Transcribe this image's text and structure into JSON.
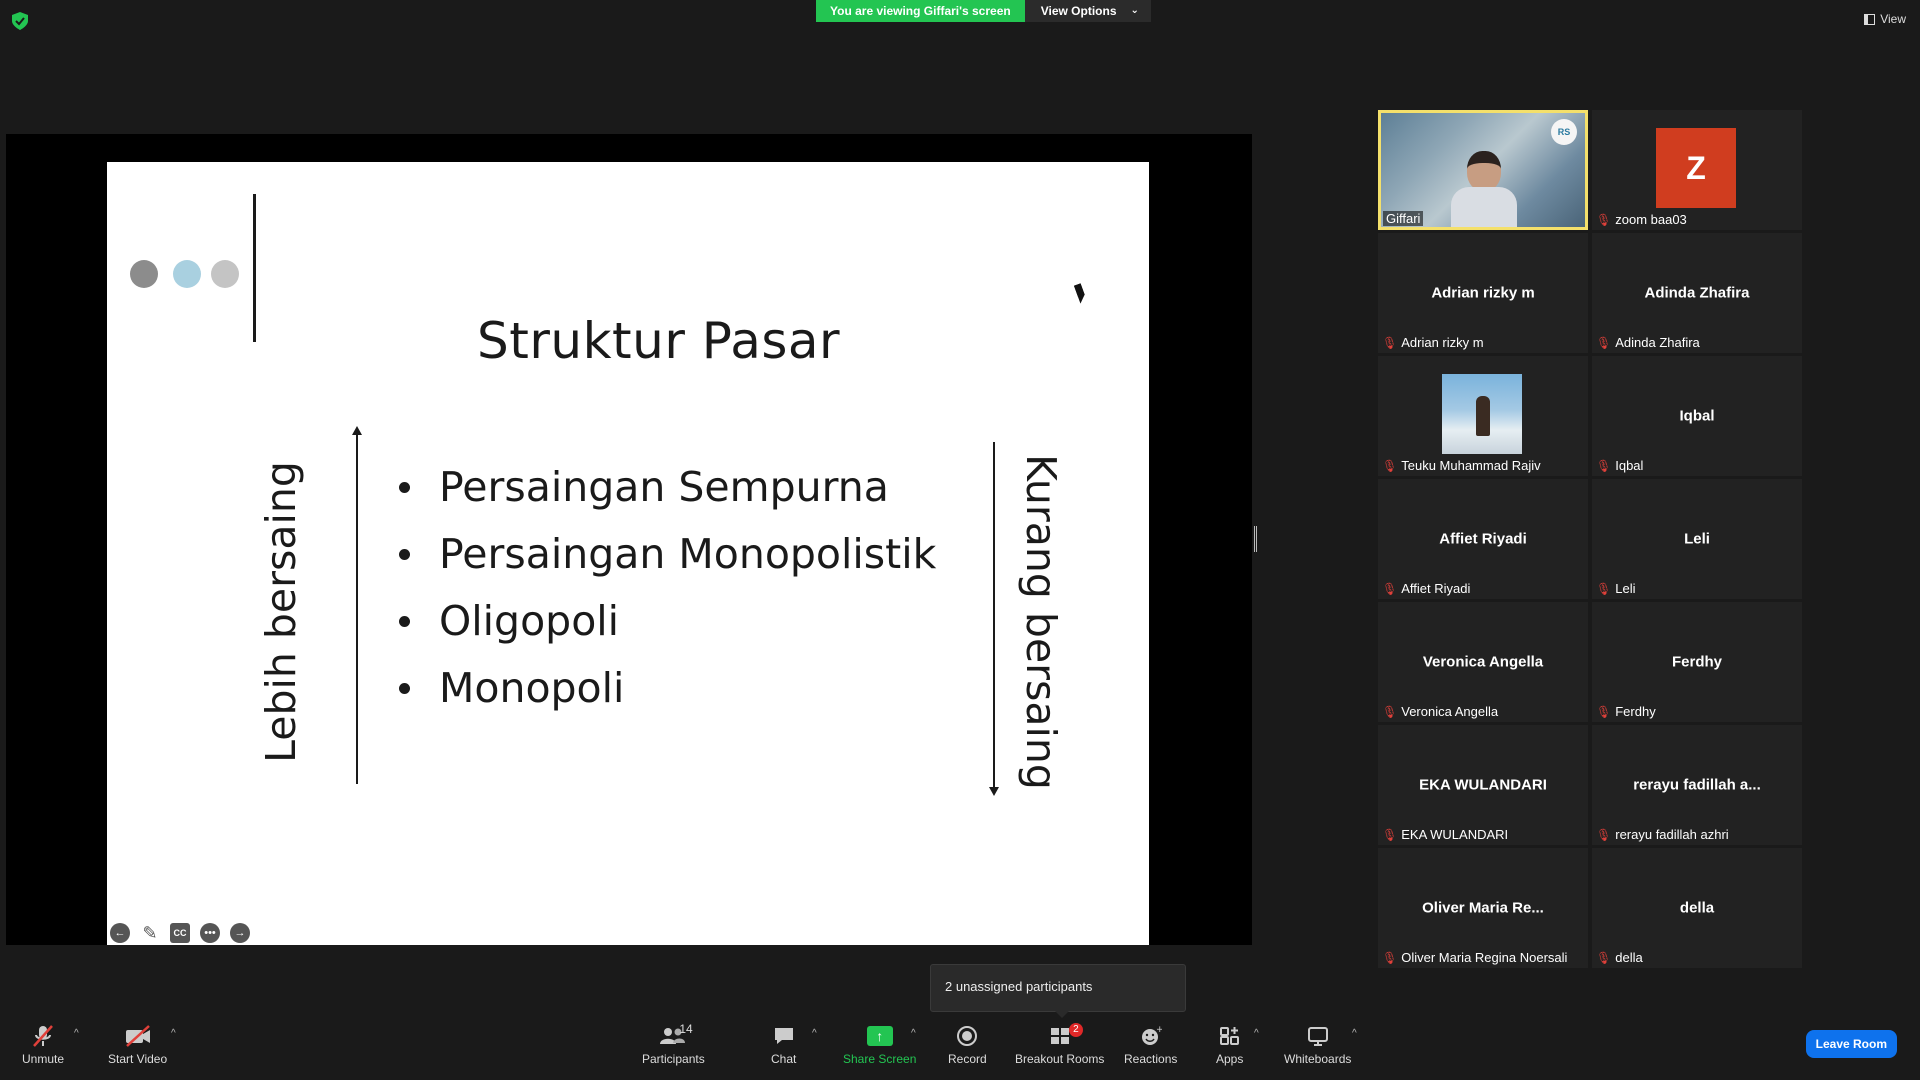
{
  "top_bar": {
    "viewing_label": "You are viewing Giffari's screen",
    "view_options": "View Options",
    "view_button": "View"
  },
  "slide": {
    "title": "Struktur Pasar",
    "bullets": [
      "Persaingan Sempurna",
      "Persaingan Monopolistik",
      "Oligopoli",
      "Monopoli"
    ],
    "left_label": "Lebih bersaing",
    "right_label": "Kurang bersaing",
    "tools": {
      "cc": "CC"
    }
  },
  "gallery": {
    "active_speaker": {
      "name": "Giffari"
    },
    "tiles": [
      {
        "display": "",
        "tag": "zoom baa03",
        "avatar_letter": "Z",
        "avatar_color": "#d03d1f"
      },
      {
        "display": "Adrian rizky m",
        "tag": "Adrian rizky m"
      },
      {
        "display": "Adinda Zhafira",
        "tag": "Adinda Zhafira"
      },
      {
        "display": "",
        "tag": "Teuku Muhammad Rajiv",
        "has_photo": true
      },
      {
        "display": "Iqbal",
        "tag": "Iqbal"
      },
      {
        "display": "Affiet Riyadi",
        "tag": "Affiet Riyadi"
      },
      {
        "display": "Leli",
        "tag": "Leli"
      },
      {
        "display": "Veronica Angella",
        "tag": "Veronica Angella"
      },
      {
        "display": "Ferdhy",
        "tag": "Ferdhy"
      },
      {
        "display": "EKA WULANDARI",
        "tag": "EKA WULANDARI"
      },
      {
        "display": "rerayu fadillah a...",
        "tag": "rerayu fadillah azhri"
      },
      {
        "display": "Oliver Maria Re...",
        "tag": "Oliver Maria Regina Noersali"
      },
      {
        "display": "della",
        "tag": "della"
      }
    ]
  },
  "tooltip": {
    "text": "2 unassigned participants"
  },
  "toolbar": {
    "unmute": "Unmute",
    "start_video": "Start Video",
    "participants": "Participants",
    "participants_count": "14",
    "chat": "Chat",
    "share_screen": "Share Screen",
    "record": "Record",
    "breakout_rooms": "Breakout Rooms",
    "breakout_badge": "2",
    "reactions": "Reactions",
    "apps": "Apps",
    "whiteboards": "Whiteboards",
    "leave_room": "Leave Room"
  },
  "colors": {
    "accent_green": "#23c552",
    "leave_blue": "#0e72ed",
    "muted_red": "#e0403a",
    "active_border": "#f4e06b"
  }
}
